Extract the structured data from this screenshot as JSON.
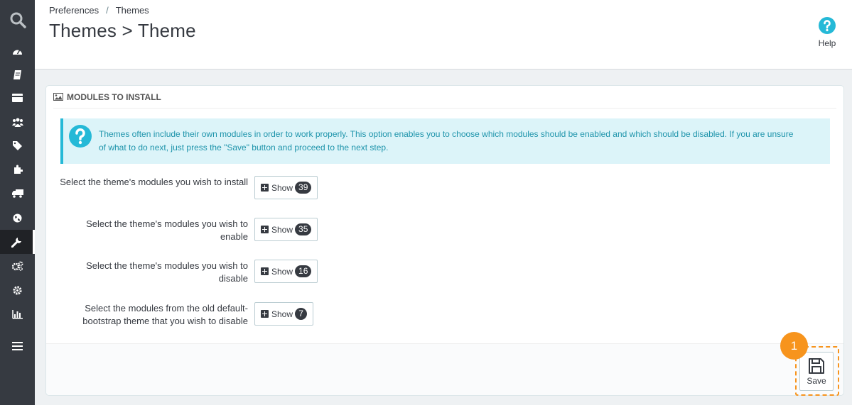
{
  "breadcrumb": [
    "Preferences",
    "Themes"
  ],
  "page_title": "Themes > Theme",
  "help_label": "Help",
  "panel": {
    "heading": "MODULES TO INSTALL",
    "alert_text": "Themes often include their own modules in order to work properly. This option enables you to choose which modules should be enabled and which should be disabled. If you are unsure of what to do next, just press the \"Save\" button and proceed to the next step.",
    "rows": [
      {
        "label": "Select the theme's modules you wish to install",
        "button": "Show",
        "count": "39"
      },
      {
        "label": "Select the theme's modules you wish to enable",
        "button": "Show",
        "count": "35"
      },
      {
        "label": "Select the theme's modules you wish to disable",
        "button": "Show",
        "count": "16"
      },
      {
        "label": "Select the modules from the old default-bootstrap theme that you wish to disable",
        "button": "Show",
        "count": "7"
      }
    ],
    "save_label": "Save"
  },
  "annotation": {
    "step": "1"
  },
  "sidebar": {
    "icons": [
      "search-icon",
      "dashboard-icon",
      "orders-icon",
      "catalog-icon",
      "customers-icon",
      "price-rules-icon",
      "modules-icon",
      "shipping-icon",
      "localization-icon",
      "preferences-icon",
      "advanced-parameters-icon",
      "administration-icon",
      "stats-icon",
      "collapse-menu-icon"
    ],
    "active": "preferences-icon"
  },
  "colors": {
    "accent": "#25b9d7",
    "annotation": "#f7941d",
    "sidebar": "#363a41"
  }
}
